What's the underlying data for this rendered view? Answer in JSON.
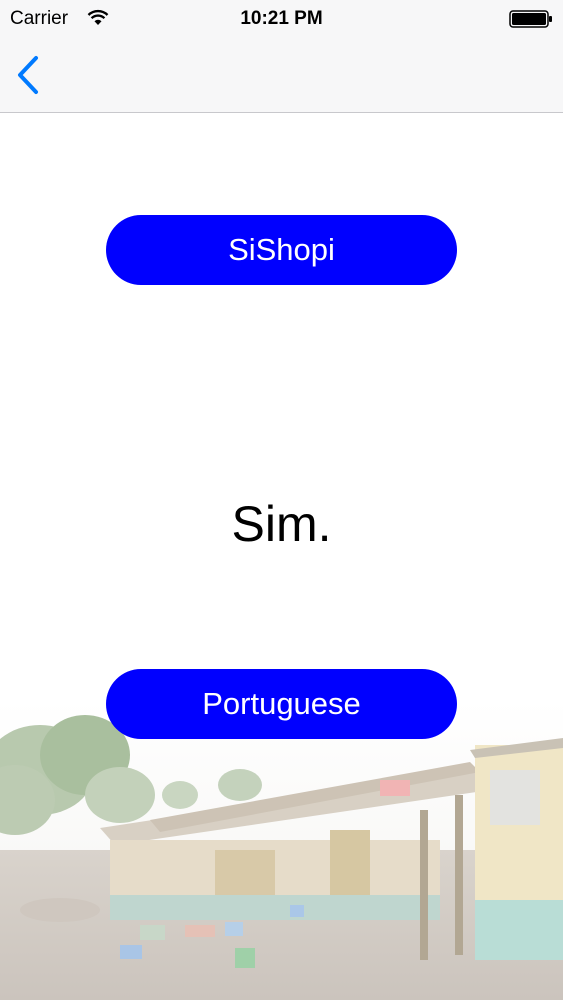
{
  "status_bar": {
    "carrier": "Carrier",
    "time": "10:21 PM"
  },
  "nav": {
    "back_icon": "chevron-left-icon"
  },
  "colors": {
    "accent": "#007aff",
    "button": "#0000ff",
    "button_text": "#ffffff"
  },
  "main": {
    "top_button_label": "SiShopi",
    "phrase": "Sim.",
    "bottom_button_label": "Portuguese"
  }
}
